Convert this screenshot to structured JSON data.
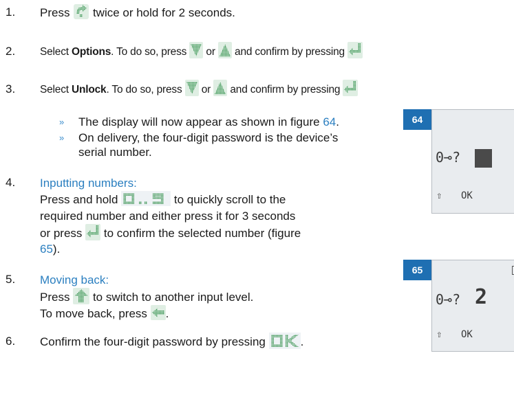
{
  "steps": [
    {
      "n": "1.",
      "pre": "Press",
      "post": "twice or hold for 2 seconds."
    },
    {
      "n": "2.",
      "pre": "Select",
      "bold": "Options",
      "mid": ". To do so, press",
      "or": "or",
      "end": "and confirm by pressing"
    },
    {
      "n": "3.",
      "pre": "Select",
      "bold": "Unlock",
      "mid": ". To do so, press",
      "or": "or",
      "end": "and confirm by pressing"
    }
  ],
  "notes": [
    {
      "text": "The display will now appear as shown in figure",
      "ref": "64",
      "tail": "."
    },
    {
      "text1": "On delivery, the four-digit password is the device’s",
      "text2": "serial number."
    }
  ],
  "step4": {
    "n": "4.",
    "heading": "Inputting numbers:",
    "l1a": "Press and hold",
    "l1b": "to quickly scroll to the",
    "l2": "required number and either press it for 3 seconds",
    "l3a": "or press",
    "l3b": "to confirm the selected number (figure",
    "ref": "65",
    "ref_tail": ")."
  },
  "step5": {
    "n": "5.",
    "heading": "Moving back:",
    "l1a": "Press",
    "l1b": "to switch to another input level.",
    "l2a": "To move back, press",
    "l2b": "."
  },
  "step6": {
    "n": "6.",
    "text": "Confirm the four-digit password by pressing",
    "tail": "."
  },
  "figures": [
    {
      "id": "64",
      "key": "0⊸?",
      "soft_left": "⇧",
      "soft_ok": "OK"
    },
    {
      "id": "65",
      "key": "0⊸?",
      "digit": "2",
      "soft_left": "⇧",
      "soft_ok": "OK"
    }
  ],
  "icon_names": [
    "menu-key-icon",
    "down-arrow-key-icon",
    "up-arrow-key-icon",
    "enter-key-icon",
    "digit-keys-icon",
    "shift-key-icon",
    "back-key-icon",
    "ok-key-icon"
  ],
  "colors": {
    "accent": "#2b7fc0",
    "badge": "#1f6fb2",
    "icon": "#3aa15a"
  }
}
